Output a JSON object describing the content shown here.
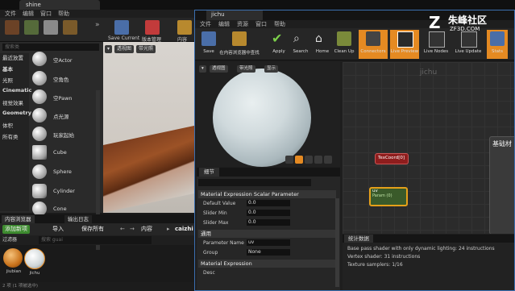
{
  "main_window": {
    "tab_title": "shine",
    "menu": [
      "文件",
      "编辑",
      "窗口",
      "帮助"
    ],
    "toolbar": {
      "save_current": "Save Current",
      "content": "版本管理",
      "settings": "内容"
    },
    "place": {
      "search_placeholder": "搜索类",
      "categories": [
        "最近放置",
        "基本",
        "光照",
        "Cinematic",
        "视觉效果",
        "Geometry",
        "体积",
        "所有类"
      ],
      "items": [
        "空Actor",
        "空角色",
        "空Pawn",
        "点光源",
        "玩家起始",
        "Cube",
        "Sphere",
        "Cylinder",
        "Cone"
      ]
    },
    "viewport": {
      "perspective": "透视图",
      "lit": "带光照"
    }
  },
  "content_browser": {
    "tabs": [
      "内容浏览器",
      "输出日志"
    ],
    "add_new": "添加新项",
    "import": "导入",
    "save_all": "保存所有",
    "path_content": "内容",
    "path_folder": "caizhi",
    "filter": "过滤器",
    "search_placeholder": "搜索 guai",
    "assets": [
      "jiubian",
      "jichu"
    ],
    "status": "2 项 (1 项被选中)"
  },
  "material_editor": {
    "tab_title": "jichu",
    "menu": [
      "文件",
      "编辑",
      "资源",
      "窗口",
      "帮助"
    ],
    "toolbar": [
      "Save",
      "在内容浏览器中查找",
      "Apply",
      "Search",
      "Home",
      "Clean Up",
      "Connectors",
      "Live Preview",
      "Live Nodes",
      "Live Update",
      "Stats"
    ],
    "preview": {
      "perspective": "透视图",
      "lit": "带光照",
      "show": "显示"
    },
    "details": {
      "tab": "细节",
      "section_param": "Material Expression Scalar Parameter",
      "default_value_label": "Default Value",
      "default_value": "0.0",
      "slider_min_label": "Slider Min",
      "slider_min": "0.0",
      "slider_max_label": "Slider Max",
      "slider_max": "0.0",
      "section_general": "通用",
      "param_name_label": "Parameter Name",
      "param_name": "uv",
      "group_label": "Group",
      "group": "None",
      "section_expr": "Material Expression",
      "desc_label": "Desc"
    },
    "graph": {
      "title": "jichu",
      "node_texcoord": "TexCoord[0]",
      "node_uv": "uv",
      "node_uv_sub": "Param (0)",
      "main_node_label": "基础材"
    },
    "stats": {
      "tab": "统计数据",
      "lines": [
        "Base pass shader with only dynamic lighting: 24 instructions",
        "Vertex shader: 31 instructions",
        "Texture samplers: 1/16"
      ]
    }
  },
  "watermark": {
    "name": "朱峰社区",
    "url": "ZF3D.COM"
  },
  "colors": {
    "accent_orange": "#e58a22",
    "accent_green": "#3d8b2f",
    "window_border": "#3b6fb0"
  }
}
